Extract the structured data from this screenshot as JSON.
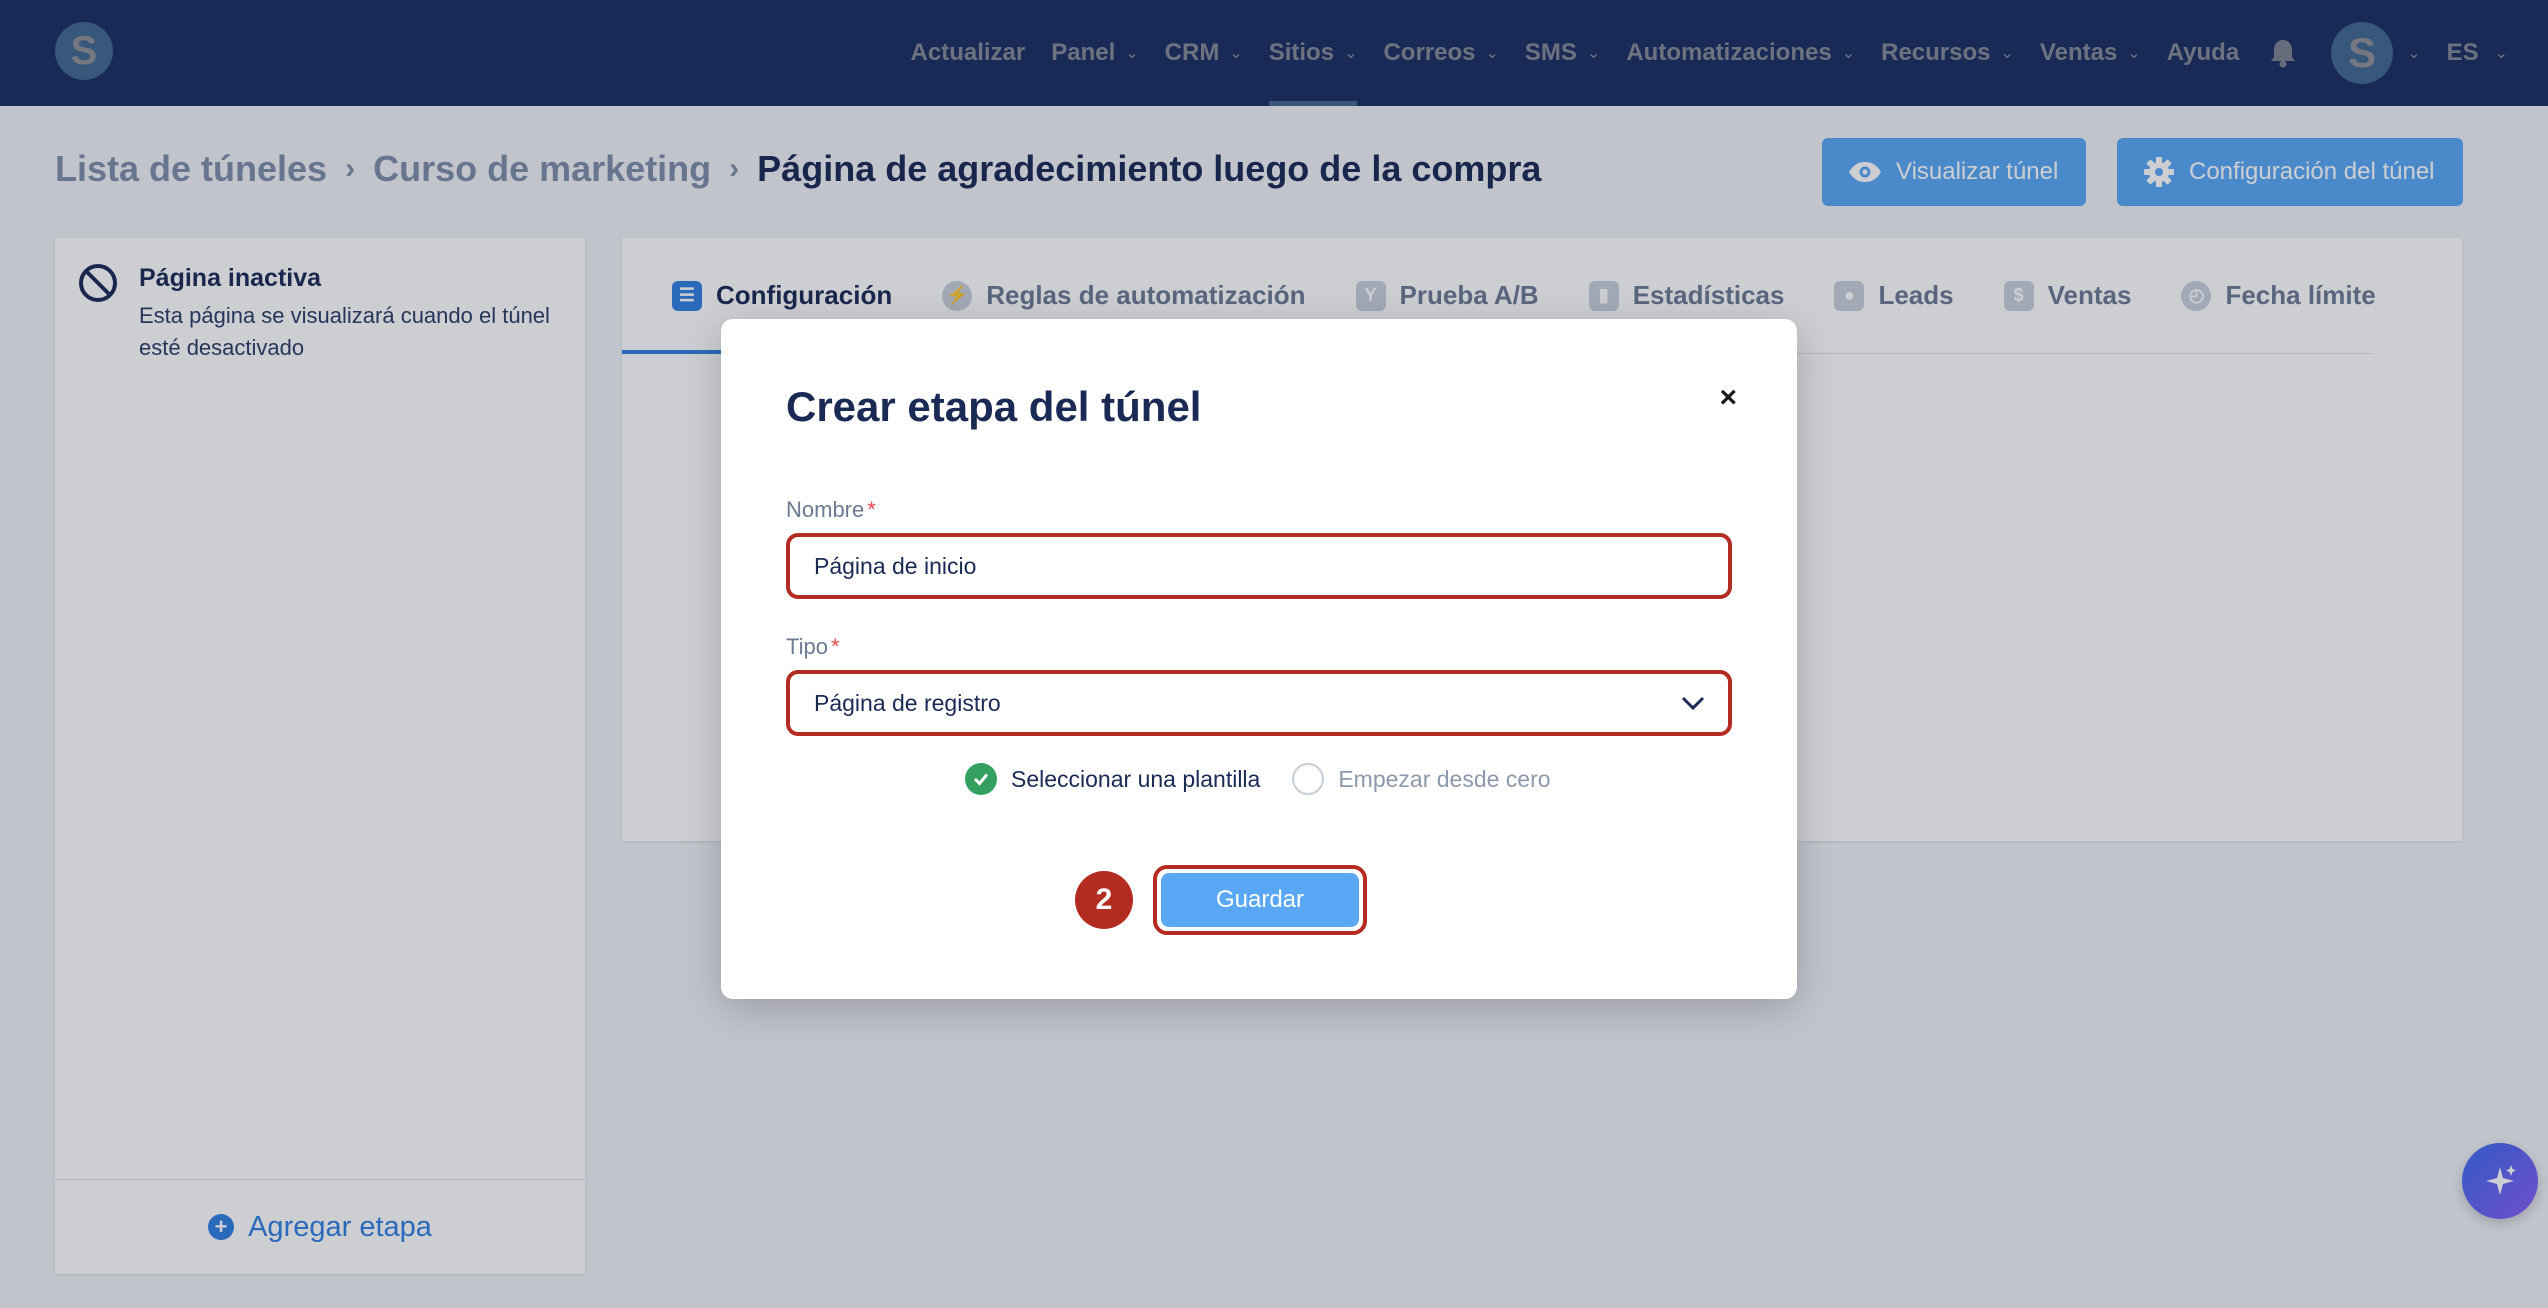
{
  "nav": {
    "logo": "S",
    "items": [
      {
        "label": "Actualizar",
        "dropdown": false,
        "active": false
      },
      {
        "label": "Panel",
        "dropdown": true,
        "active": false
      },
      {
        "label": "CRM",
        "dropdown": true,
        "active": false
      },
      {
        "label": "Sitios",
        "dropdown": true,
        "active": true
      },
      {
        "label": "Correos",
        "dropdown": true,
        "active": false
      },
      {
        "label": "SMS",
        "dropdown": true,
        "active": false
      },
      {
        "label": "Automatizaciones",
        "dropdown": true,
        "active": false
      },
      {
        "label": "Recursos",
        "dropdown": true,
        "active": false
      },
      {
        "label": "Ventas",
        "dropdown": true,
        "active": false
      },
      {
        "label": "Ayuda",
        "dropdown": false,
        "active": false
      }
    ],
    "avatar_letter": "S",
    "language": "ES"
  },
  "breadcrumb": {
    "items": [
      "Lista de túneles",
      "Curso de marketing"
    ],
    "current": "Página de agradecimiento luego de la compra"
  },
  "header_buttons": {
    "preview": "Visualizar túnel",
    "settings": "Configuración del túnel"
  },
  "left_panel": {
    "inactive_title": "Página inactiva",
    "inactive_desc": "Esta página se visualizará cuando el túnel esté desactivado",
    "add_stage": "Agregar etapa"
  },
  "tabs": [
    {
      "label": "Configuración",
      "icon": "sliders-icon",
      "active": true
    },
    {
      "label": "Reglas de automatización",
      "icon": "bolt-icon",
      "active": false
    },
    {
      "label": "Prueba A/B",
      "icon": "split-icon",
      "active": false
    },
    {
      "label": "Estadísticas",
      "icon": "bar-chart-icon",
      "active": false
    },
    {
      "label": "Leads",
      "icon": "users-icon",
      "active": false
    },
    {
      "label": "Ventas",
      "icon": "dollar-icon",
      "active": false
    },
    {
      "label": "Fecha límite",
      "icon": "clock-icon",
      "active": false
    }
  ],
  "modal": {
    "title": "Crear etapa del túnel",
    "name_label": "Nombre",
    "name_value": "Página de inicio",
    "type_label": "Tipo",
    "type_value": "Página de registro",
    "required_mark": "*",
    "option_template": "Seleccionar una plantilla",
    "option_scratch": "Empezar desde cero",
    "selected_option": "template",
    "step_badge": "2",
    "save_label": "Guardar",
    "close_symbol": "×"
  },
  "colors": {
    "nav_bg": "#2b4a9b",
    "accent": "#5aa8f5",
    "highlight": "#b32c22",
    "success": "#33a05f"
  }
}
